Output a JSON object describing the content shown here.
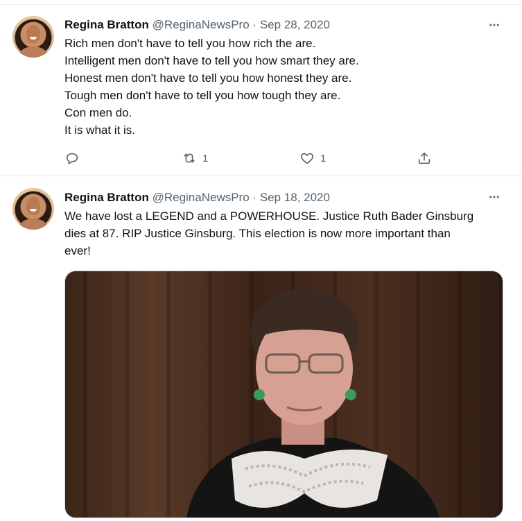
{
  "tweets": [
    {
      "author_name": "Regina Bratton",
      "handle": "@ReginaNewsPro",
      "separator": "·",
      "date": "Sep 28, 2020",
      "lines": [
        "Rich men don't have to tell you how rich the are.",
        "Intelligent men don't have to tell you how smart they are.",
        "Honest men don't have to tell you how honest they are.",
        "Tough men don't have to tell you how tough they are.",
        "Con men do.",
        "It is what it is."
      ],
      "reply_count": "",
      "retweet_count": "1",
      "like_count": "1"
    },
    {
      "author_name": "Regina Bratton",
      "handle": "@ReginaNewsPro",
      "separator": "·",
      "date": "Sep 18, 2020",
      "lines": [
        "We have lost a LEGEND and a POWERHOUSE. Justice Ruth Bader Ginsburg",
        "dies at 87.  RIP Justice Ginsburg.  This election is now more important than",
        "ever!"
      ],
      "has_photo": true
    }
  ],
  "icons": {
    "more": "more-horizontal-icon",
    "reply": "reply-icon",
    "retweet": "retweet-icon",
    "like": "heart-icon",
    "share": "share-icon"
  },
  "colors": {
    "text": "#0f1419",
    "secondary": "#536471",
    "border": "#eff3f4"
  }
}
